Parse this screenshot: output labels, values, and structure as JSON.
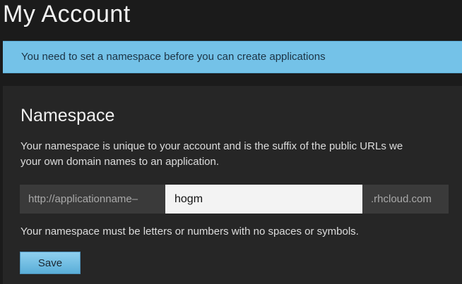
{
  "page": {
    "title": "My Account"
  },
  "alert": {
    "message": "You need to set a namespace before you can create applications"
  },
  "namespace_section": {
    "title": "Namespace",
    "description_line1": "Your namespace is unique to your account and is the suffix of the public URLs we",
    "description_line2": "your own domain names to an application.",
    "url_prefix": "http://applicationname–",
    "input_value": "hogm",
    "url_suffix": ".rhcloud.com",
    "hint": "Your namespace must be letters or numbers with no spaces or symbols.",
    "save_label": "Save"
  },
  "colors": {
    "alert_background": "#74c2e8",
    "button_background": "#6ebde3",
    "page_background": "#1b1b1b",
    "panel_background": "#262626"
  }
}
